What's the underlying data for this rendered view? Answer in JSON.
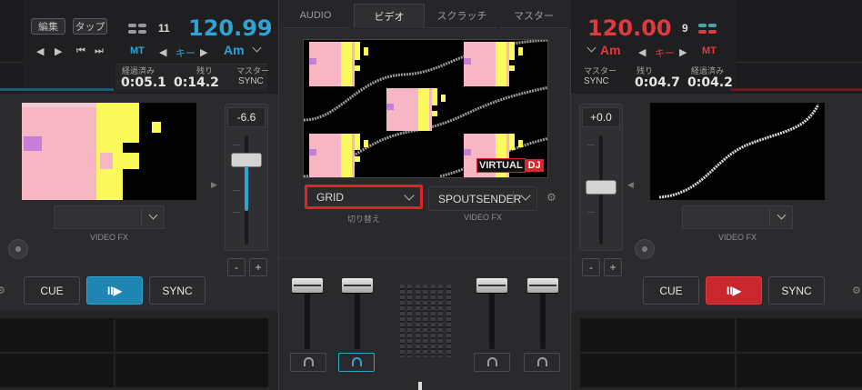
{
  "left_deck": {
    "edit_label": "編集",
    "tap_label": "タップ",
    "loop_count": "11",
    "bpm": "120.99",
    "mt_label": "MT",
    "key_label": "キー",
    "key_value": "Am",
    "elapsed_label": "経過済み",
    "elapsed_value": "0:05.1",
    "remain_label": "残り",
    "remain_value": "0:14.2",
    "master_label": "マスター",
    "sync_small": "SYNC",
    "pitch_value": "-6.6",
    "video_fx_caption": "VIDEO FX",
    "cue_label": "CUE",
    "play_label": "II▶",
    "sync_label": "SYNC",
    "minus_label": "-",
    "plus_label": "+",
    "accent_color": "#2fa3d4"
  },
  "center": {
    "tabs": [
      {
        "label": "AUDIO"
      },
      {
        "label": "ビデオ"
      },
      {
        "label": "スクラッチ"
      },
      {
        "label": "マスター"
      }
    ],
    "active_tab": "ビデオ",
    "transition_value": "GRID",
    "transition_caption": "切り替え",
    "video_fx_value": "SPOUTSENDER",
    "video_fx_caption": "VIDEO FX",
    "logo_text_a": "VIRTUAL",
    "logo_text_b": "DJ",
    "highlight_color": "#e0242e"
  },
  "right_deck": {
    "bpm": "120.00",
    "loop_count": "9",
    "mt_label": "MT",
    "key_label": "キー",
    "key_value": "Am",
    "master_label": "マスター",
    "sync_small": "SYNC",
    "remain_label": "残り",
    "remain_value": "0:04.7",
    "elapsed_label": "経過済み",
    "elapsed_value": "0:04.2",
    "pitch_value": "+0.0",
    "video_fx_caption": "VIDEO FX",
    "cue_label": "CUE",
    "play_label": "II▶",
    "sync_label": "SYNC",
    "minus_label": "-",
    "plus_label": "+",
    "accent_color": "#e03a3e"
  }
}
